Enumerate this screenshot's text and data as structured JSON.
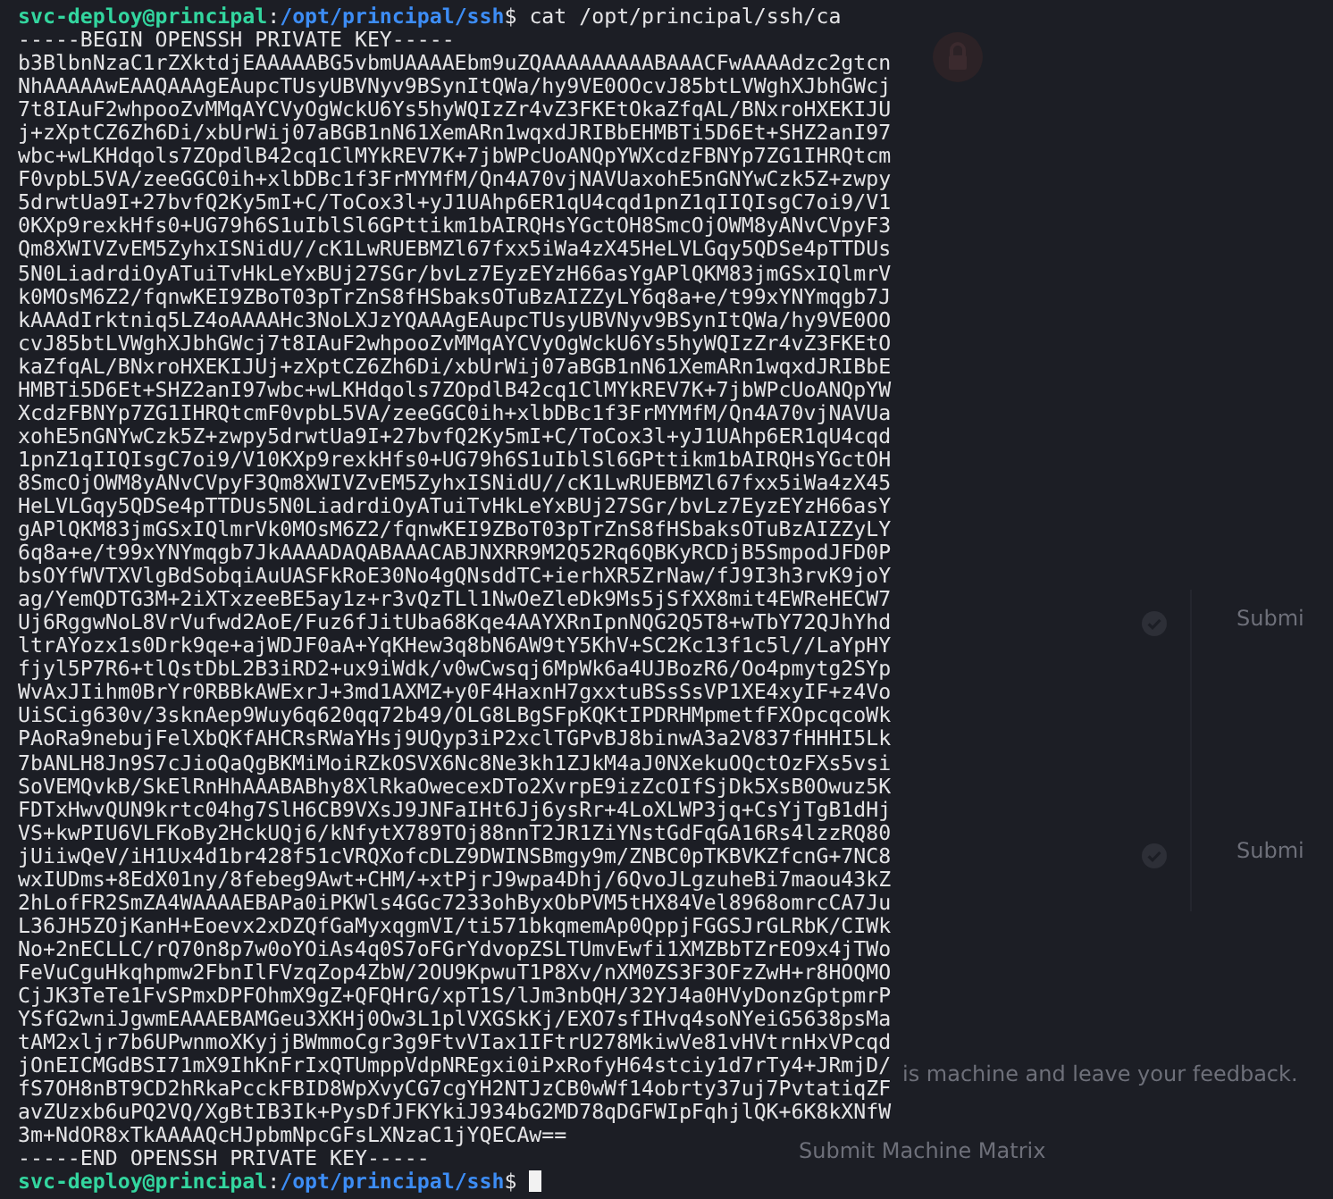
{
  "terminal": {
    "lines": [
      {
        "kind": "prompt",
        "user_host": "svc-deploy@principal",
        "separator": ":",
        "path": "/opt/principal/ssh",
        "symbol": "$",
        "command": "cat /opt/principal/ssh/ca",
        "cursor": false
      },
      {
        "kind": "output",
        "text": "-----BEGIN OPENSSH PRIVATE KEY-----"
      },
      {
        "kind": "output",
        "text": "b3BlbnNzaC1rZXktdjEAAAAABG5vbmUAAAAEbm9uZQAAAAAAAAABAAACFwAAAAdzc2gtcn"
      },
      {
        "kind": "output",
        "text": "NhAAAAAwEAAQAAAgEAupcTUsyUBVNyv9BSynItQWa/hy9VE0OOcvJ85btLVWghXJbhGWcj"
      },
      {
        "kind": "output",
        "text": "7t8IAuF2whpooZvMMqAYCVyOgWckU6Ys5hyWQIzZr4vZ3FKEtOkaZfqAL/BNxroHXEKIJU"
      },
      {
        "kind": "output",
        "text": "j+zXptCZ6Zh6Di/xbUrWij07aBGB1nN61XemARn1wqxdJRIBbEHMBTi5D6Et+SHZ2anI97"
      },
      {
        "kind": "output",
        "text": "wbc+wLKHdqols7ZOpdlB42cq1ClMYkREV7K+7jbWPcUoANQpYWXcdzFBNYp7ZG1IHRQtcm"
      },
      {
        "kind": "output",
        "text": "F0vpbL5VA/zeeGGC0ih+xlbDBc1f3FrMYMfM/Qn4A70vjNAVUaxohE5nGNYwCzk5Z+zwpy"
      },
      {
        "kind": "output",
        "text": "5drwtUa9I+27bvfQ2Ky5mI+C/ToCox3l+yJ1UAhp6ER1qU4cqd1pnZ1qIIQIsgC7oi9/V1"
      },
      {
        "kind": "output",
        "text": "0KXp9rexkHfs0+UG79h6S1uIblSl6GPttikm1bAIRQHsYGctOH8SmcOjOWM8yANvCVpyF3"
      },
      {
        "kind": "output",
        "text": "Qm8XWIVZvEM5ZyhxISNidU//cK1LwRUEBMZl67fxx5iWa4zX45HeLVLGqy5QDSe4pTTDUs"
      },
      {
        "kind": "output",
        "text": "5N0LiadrdiOyATuiTvHkLeYxBUj27SGr/bvLz7EyzEYzH66asYgAPlQKM83jmGSxIQlmrV"
      },
      {
        "kind": "output",
        "text": "k0MOsM6Z2/fqnwKEI9ZBoT03pTrZnS8fHSbaksOTuBzAIZZyLY6q8a+e/t99xYNYmqgb7J"
      },
      {
        "kind": "output",
        "text": "kAAAdIrktniq5LZ4oAAAAHc3NoLXJzYQAAAgEAupcTUsyUBVNyv9BSynItQWa/hy9VE0OO"
      },
      {
        "kind": "output",
        "text": "cvJ85btLVWghXJbhGWcj7t8IAuF2whpooZvMMqAYCVyOgWckU6Ys5hyWQIzZr4vZ3FKEtO"
      },
      {
        "kind": "output",
        "text": "kaZfqAL/BNxroHXEKIJUj+zXptCZ6Zh6Di/xbUrWij07aBGB1nN61XemARn1wqxdJRIBbE"
      },
      {
        "kind": "output",
        "text": "HMBTi5D6Et+SHZ2anI97wbc+wLKHdqols7ZOpdlB42cq1ClMYkREV7K+7jbWPcUoANQpYW"
      },
      {
        "kind": "output",
        "text": "XcdzFBNYp7ZG1IHRQtcmF0vpbL5VA/zeeGGC0ih+xlbDBc1f3FrMYMfM/Qn4A70vjNAVUa"
      },
      {
        "kind": "output",
        "text": "xohE5nGNYwCzk5Z+zwpy5drwtUa9I+27bvfQ2Ky5mI+C/ToCox3l+yJ1UAhp6ER1qU4cqd"
      },
      {
        "kind": "output",
        "text": "1pnZ1qIIQIsgC7oi9/V10KXp9rexkHfs0+UG79h6S1uIblSl6GPttikm1bAIRQHsYGctOH"
      },
      {
        "kind": "output",
        "text": "8SmcOjOWM8yANvCVpyF3Qm8XWIVZvEM5ZyhxISNidU//cK1LwRUEBMZl67fxx5iWa4zX45"
      },
      {
        "kind": "output",
        "text": "HeLVLGqy5QDSe4pTTDUs5N0LiadrdiOyATuiTvHkLeYxBUj27SGr/bvLz7EyzEYzH66asY"
      },
      {
        "kind": "output",
        "text": "gAPlQKM83jmGSxIQlmrVk0MOsM6Z2/fqnwKEI9ZBoT03pTrZnS8fHSbaksOTuBzAIZZyLY"
      },
      {
        "kind": "output",
        "text": "6q8a+e/t99xYNYmqgb7JkAAAADAQABAAACABJNXRR9M2Q52Rq6QBKyRCDjB5SmpodJFD0P"
      },
      {
        "kind": "output",
        "text": "bsOYfWVTXVlgBdSobqiAuUASFkRoE30No4gQNsddTC+ierhXR5ZrNaw/fJ9I3h3rvK9joY"
      },
      {
        "kind": "output",
        "text": "ag/YemQDTG3M+2iXTxzeeBE5ay1z+r3vQzTLl1NwOeZleDk9Ms5jSfXX8mit4EWReHECW7"
      },
      {
        "kind": "output",
        "text": "Uj6RggwNoL8VrVufwd2AoE/Fuz6fJitUba68Kqe4AAYXRnIpnNQG2Q5T8+wTbY72QJhYhd"
      },
      {
        "kind": "output",
        "text": "ltrAYozx1s0Drk9qe+ajWDJF0aA+YqKHew3q8bN6AW9tY5KhV+SC2Kc13f1c5l//LaYpHY"
      },
      {
        "kind": "output",
        "text": "fjyl5P7R6+tlQstDbL2B3iRD2+ux9iWdk/v0wCwsqj6MpWk6a4UJBozR6/Oo4pmytg2SYp"
      },
      {
        "kind": "output",
        "text": "WvAxJIihm0BrYr0RBBkAWExrJ+3md1AXMZ+y0F4HaxnH7gxxtuBSsSsVP1XE4xyIF+z4Vo"
      },
      {
        "kind": "output",
        "text": "UiSCig630v/3sknAep9Wuy6q620qq72b49/OLG8LBgSFpKQKtIPDRHMpmetfFXOpcqcoWk"
      },
      {
        "kind": "output",
        "text": "PAoRa9nebujFelXbQKfAHCRsRWaYHsj9UQyp3iP2xclTGPvBJ8binwA3a2V837fHHHI5Lk"
      },
      {
        "kind": "output",
        "text": "7bANLH8Jn9S7cJioQaQgBKMiMoiRZkOSVX6Nc8Ne3kh1ZJkM4aJ0NXekuOQctOzFXs5vsi"
      },
      {
        "kind": "output",
        "text": "SoVEMQvkB/SkElRnHhAAABABhy8XlRkaOwecexDTo2XvrpE9izZcOIfSjDk5XsB0Owuz5K"
      },
      {
        "kind": "output",
        "text": "FDTxHwvQUN9krtc04hg7SlH6CB9VXsJ9JNFaIHt6Jj6ysRr+4LoXLWP3jq+CsYjTgB1dHj"
      },
      {
        "kind": "output",
        "text": "VS+kwPIU6VLFKoBy2HckUQj6/kNfytX789TOj88nnT2JR1ZiYNstGdFqGA16Rs4lzzRQ80"
      },
      {
        "kind": "output",
        "text": "jUiiwQeV/iH1Ux4d1br428f51cVRQXofcDLZ9DWINSBmgy9m/ZNBC0pTKBVKZfcnG+7NC8"
      },
      {
        "kind": "output",
        "text": "wxIUDms+8EdX01ny/8febeg9Awt+CHM/+xtPjrJ9wpa4Dhj/6QvoJLgzuheBi7maou43kZ"
      },
      {
        "kind": "output",
        "text": "2hLofFR2SmZA4WAAAAEBAPa0iPKWls4GGc7233ohByxObPVM5tHX84Vel8968omrcCA7Ju"
      },
      {
        "kind": "output",
        "text": "L36JH5ZOjKanH+Eoevx2xDZQfGaMyxqgmVI/ti571bkqmemAp0QppjFGGSJrGLRbK/CIWk"
      },
      {
        "kind": "output",
        "text": "No+2nECLLC/rQ70n8p7w0oYOiAs4q0S7oFGrYdvopZSLTUmvEwfi1XMZBbTZrEO9x4jTWo"
      },
      {
        "kind": "output",
        "text": "FeVuCguHkqhpmw2FbnIlFVzqZop4ZbW/2OU9KpwuT1P8Xv/nXM0ZS3F3OFzZwH+r8HOQMO"
      },
      {
        "kind": "output",
        "text": "CjJK3TeTe1FvSPmxDPFOhmX9gZ+QFQHrG/xpT1S/lJm3nbQH/32YJ4a0HVyDonzGptpmrP"
      },
      {
        "kind": "output",
        "text": "YSfG2wniJgwmEAAAEBAMGeu3XKHj0Ow3L1plVXGSkKj/EXO7sfIHvq4soNYeiG5638psMa"
      },
      {
        "kind": "output",
        "text": "tAM2xljr7b6UPwnmoXKyjjBWmmoCgr3g9FtvVIax1IFtrU278MkiwVe81vHVtrnHxVPcqd"
      },
      {
        "kind": "output",
        "text": "jOnEICMGdBSI71mX9IhKnFrIxQTUmppVdpNREgxi0iPxRofyH64stciy1d7rTy4+JRmjD/"
      },
      {
        "kind": "output",
        "text": "fS7OH8nBT9CD2hRkaPcckFBID8WpXvyCG7cgYH2NTJzCB0wWf14obrty37uj7PvtatiqZF"
      },
      {
        "kind": "output",
        "text": "avZUzxb6uPQ2VQ/XgBtIB3Ik+PysDfJFKYkiJ934bG2MD78qDGFWIpFqhjlQK+6K8kXNfW"
      },
      {
        "kind": "output",
        "text": "3m+NdOR8xTkAAAAQcHJpbmNpcGFsLXNzaC1jYQECAw=="
      },
      {
        "kind": "output",
        "text": "-----END OPENSSH PRIVATE KEY-----"
      },
      {
        "kind": "prompt",
        "user_host": "svc-deploy@principal",
        "separator": ":",
        "path": "/opt/principal/ssh",
        "symbol": "$",
        "cursor": true
      }
    ]
  },
  "background_page": {
    "truncated_buttons": [
      "Submi",
      "Submi"
    ],
    "feedback_text": "is machine and leave your feedback.",
    "submit_text": "Submit Machine Matrix"
  }
}
